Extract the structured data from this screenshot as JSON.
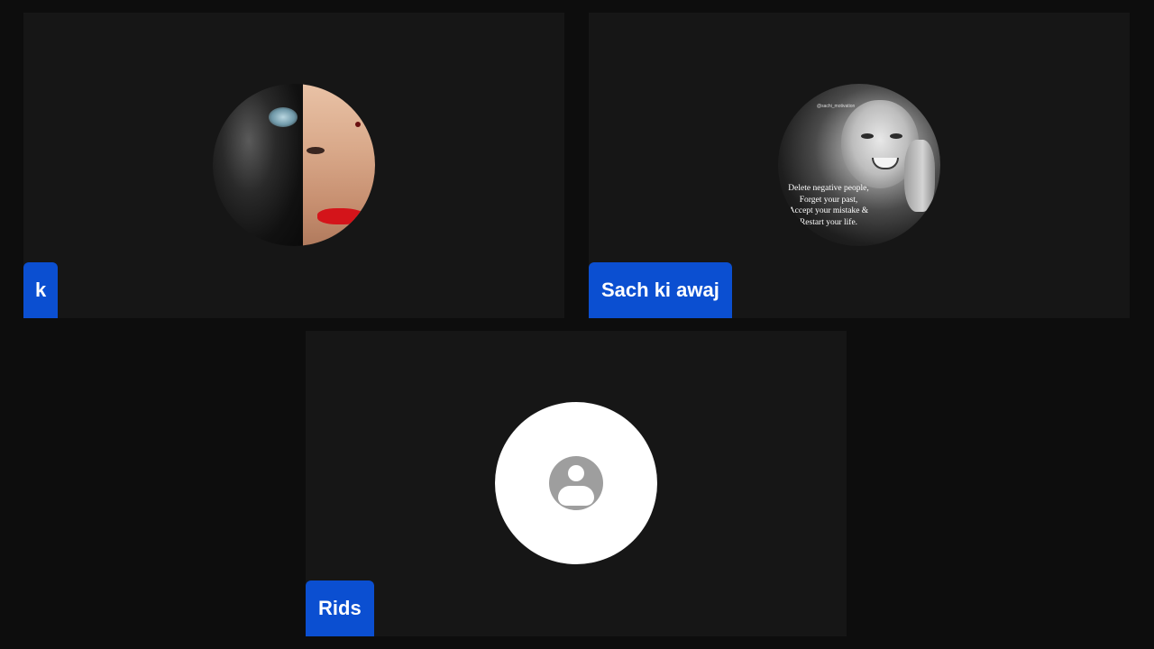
{
  "participants": [
    {
      "name": "k",
      "avatar": "photo"
    },
    {
      "name": "Sach ki awaj",
      "avatar": "photo",
      "avatar_handle": "@sachi_motivation",
      "avatar_quote": [
        "Delete negative people,",
        "Forget your past,",
        "Accept your mistake &",
        "Restart your life."
      ]
    },
    {
      "name": "Rids",
      "avatar": "default-person-icon"
    }
  ],
  "colors": {
    "background": "#0d0d0d",
    "tile": "#161616",
    "name_tag": "#0b4fd1",
    "name_text": "#ffffff",
    "placeholder_avatar": "#ffffff",
    "placeholder_icon": "#9e9e9e"
  }
}
